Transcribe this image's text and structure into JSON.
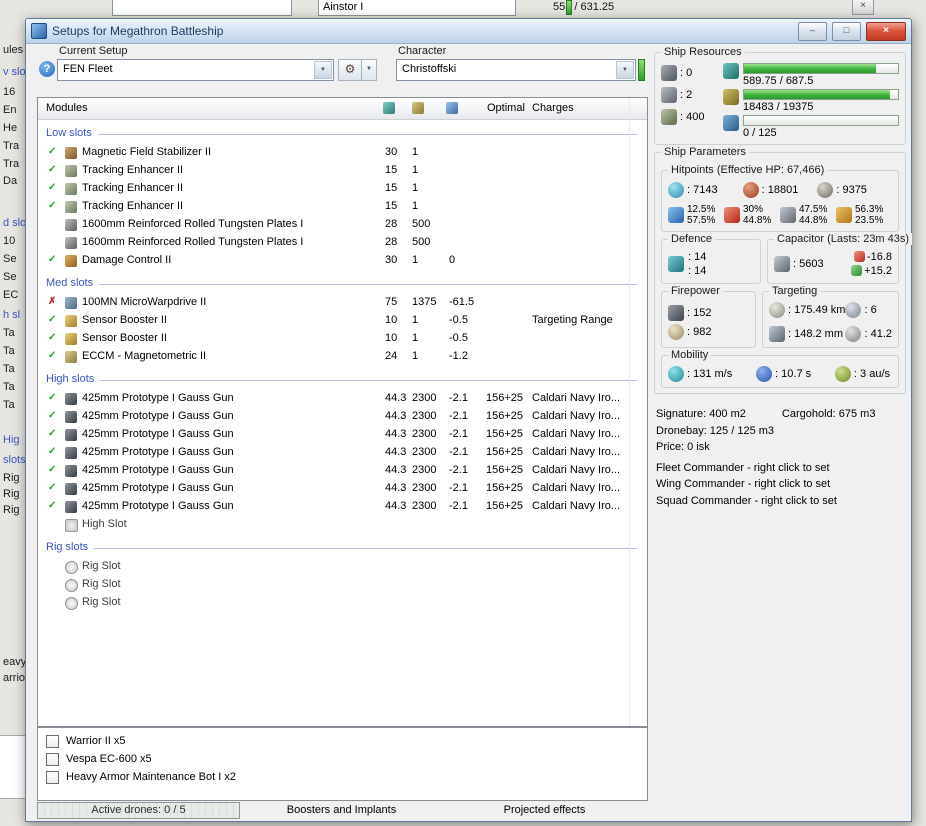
{
  "background": {
    "top_character": "Ainstor I",
    "top_value": "555 / 631.25",
    "close_glyph": "×",
    "left_fragments": [
      "ules",
      "v slot",
      "16",
      "En",
      "He",
      "Tra",
      "Tra",
      "Da",
      "d slot",
      "10",
      "Se",
      "Se",
      "EC",
      "h sl",
      "Ta",
      "Ta",
      "Ta",
      "Ta",
      "Ta",
      "Hig",
      "slots",
      "Rig",
      "Rig",
      "Rig",
      "eavy",
      "arrio"
    ]
  },
  "window": {
    "title": "Setups for Megathron Battleship",
    "minimize_glyph": "–",
    "maximize_glyph": "□",
    "close_glyph": "×"
  },
  "setup_bar": {
    "help_glyph": "?",
    "current_setup_label": "Current Setup",
    "current_setup_value": "FEN Fleet",
    "tool_glyph": "⚙",
    "dropdown_glyph": "▼",
    "character_label": "Character",
    "character_value": "Christoffski"
  },
  "modules_table": {
    "modules_header": "Modules",
    "optimal_header": "Optimal",
    "charges_header": "Charges",
    "sections": [
      {
        "label": "Low slots",
        "rows": [
          {
            "status": "ok",
            "icon": "magnetic-field-stabilizer-icon",
            "name": "Magnetic Field Stabilizer II",
            "cpu": "30",
            "pg": "1"
          },
          {
            "status": "ok",
            "icon": "tracking-enhancer-icon",
            "name": "Tracking Enhancer II",
            "cpu": "15",
            "pg": "1"
          },
          {
            "status": "ok",
            "icon": "tracking-enhancer-icon",
            "name": "Tracking Enhancer II",
            "cpu": "15",
            "pg": "1"
          },
          {
            "status": "ok",
            "icon": "tracking-enhancer-icon",
            "name": "Tracking Enhancer II",
            "cpu": "15",
            "pg": "1"
          },
          {
            "status": "none",
            "icon": "armor-plate-icon",
            "name": "1600mm Reinforced Rolled Tungsten Plates I",
            "cpu": "28",
            "pg": "500"
          },
          {
            "status": "none",
            "icon": "armor-plate-icon",
            "name": "1600mm Reinforced Rolled Tungsten Plates I",
            "cpu": "28",
            "pg": "500"
          },
          {
            "status": "ok",
            "icon": "damage-control-icon",
            "name": "Damage Control II",
            "cpu": "30",
            "pg": "1",
            "cap": "0"
          }
        ]
      },
      {
        "label": "Med slots",
        "rows": [
          {
            "status": "bad",
            "icon": "microwarpdrive-icon",
            "name": "100MN MicroWarpdrive II",
            "cpu": "75",
            "pg": "1375",
            "cap": "-61.5"
          },
          {
            "status": "ok",
            "icon": "sensor-booster-icon",
            "name": "Sensor Booster II",
            "cpu": "10",
            "pg": "1",
            "cap": "-0.5",
            "charges": "Targeting Range"
          },
          {
            "status": "ok",
            "icon": "sensor-booster-icon",
            "name": "Sensor Booster II",
            "cpu": "10",
            "pg": "1",
            "cap": "-0.5"
          },
          {
            "status": "ok",
            "icon": "eccm-icon",
            "name": "ECCM - Magnetometric II",
            "cpu": "24",
            "pg": "1",
            "cap": "-1.2"
          }
        ]
      },
      {
        "label": "High slots",
        "rows": [
          {
            "status": "ok",
            "icon": "railgun-icon",
            "name": "425mm Prototype I Gauss Gun",
            "cpu": "44.3",
            "pg": "2300",
            "cap": "-2.1",
            "optimal": "156+25",
            "charges": "Caldari Navy Iro..."
          },
          {
            "status": "ok",
            "icon": "railgun-icon",
            "name": "425mm Prototype I Gauss Gun",
            "cpu": "44.3",
            "pg": "2300",
            "cap": "-2.1",
            "optimal": "156+25",
            "charges": "Caldari Navy Iro..."
          },
          {
            "status": "ok",
            "icon": "railgun-icon",
            "name": "425mm Prototype I Gauss Gun",
            "cpu": "44.3",
            "pg": "2300",
            "cap": "-2.1",
            "optimal": "156+25",
            "charges": "Caldari Navy Iro..."
          },
          {
            "status": "ok",
            "icon": "railgun-icon",
            "name": "425mm Prototype I Gauss Gun",
            "cpu": "44.3",
            "pg": "2300",
            "cap": "-2.1",
            "optimal": "156+25",
            "charges": "Caldari Navy Iro..."
          },
          {
            "status": "ok",
            "icon": "railgun-icon",
            "name": "425mm Prototype I Gauss Gun",
            "cpu": "44.3",
            "pg": "2300",
            "cap": "-2.1",
            "optimal": "156+25",
            "charges": "Caldari Navy Iro..."
          },
          {
            "status": "ok",
            "icon": "railgun-icon",
            "name": "425mm Prototype I Gauss Gun",
            "cpu": "44.3",
            "pg": "2300",
            "cap": "-2.1",
            "optimal": "156+25",
            "charges": "Caldari Navy Iro..."
          },
          {
            "status": "ok",
            "icon": "railgun-icon",
            "name": "425mm Prototype I Gauss Gun",
            "cpu": "44.3",
            "pg": "2300",
            "cap": "-2.1",
            "optimal": "156+25",
            "charges": "Caldari Navy Iro..."
          },
          {
            "status": "none",
            "icon": "empty-high-slot-icon",
            "name": "High Slot",
            "empty": true
          }
        ]
      },
      {
        "label": "Rig slots",
        "rows": [
          {
            "status": "none",
            "icon": "rig-slot-icon",
            "name": "Rig Slot",
            "empty": true
          },
          {
            "status": "none",
            "icon": "rig-slot-icon",
            "name": "Rig Slot",
            "empty": true
          },
          {
            "status": "none",
            "icon": "rig-slot-icon",
            "name": "Rig Slot",
            "empty": true
          }
        ]
      }
    ]
  },
  "ship_resources": {
    "label": "Ship Resources",
    "hardpoints": [
      {
        "icon": "turret-hardpoints-icon",
        "value": ": 0"
      },
      {
        "icon": "launcher-hardpoints-icon",
        "value": ": 2"
      },
      {
        "icon": "calibration-icon",
        "value": ": 400"
      }
    ],
    "bars": [
      {
        "icon": "cpu-icon",
        "text": "589.75 / 687.5",
        "fill_pct": 86
      },
      {
        "icon": "powergrid-icon",
        "text": "18483 / 19375",
        "fill_pct": 95
      },
      {
        "icon": "drone-bandwidth-icon",
        "text": "0 / 125",
        "fill_pct": 0
      }
    ]
  },
  "ship_parameters": {
    "label": "Ship Parameters",
    "hitpoints": {
      "label": "Hitpoints (Effective HP: 67,466)",
      "shield": ": 7143",
      "armor": ": 18801",
      "hull": ": 9375",
      "resists": [
        {
          "top": "12.5%",
          "bottom": "57.5%"
        },
        {
          "top": "30%",
          "bottom": "44.8%"
        },
        {
          "top": "47.5%",
          "bottom": "44.8%"
        },
        {
          "top": "56.3%",
          "bottom": "23.5%"
        }
      ]
    },
    "defence": {
      "label": "Defence",
      "value1": ": 14",
      "value2": ": 14"
    },
    "capacitor": {
      "label": "Capacitor (Lasts: 23m 43s)",
      "capacity": ": 5603",
      "drain": "-16.8",
      "recharge": "+15.2"
    },
    "firepower": {
      "label": "Firepower",
      "volley": ": 152",
      "dps": ": 982"
    },
    "targeting": {
      "label": "Targeting",
      "range": ": 175.49 km",
      "max_targets": ": 6",
      "scan_resolution": ": 148.2 mm",
      "sensor_strength": ": 41.2"
    },
    "mobility": {
      "label": "Mobility",
      "speed": ": 131 m/s",
      "align_time": ": 10.7 s",
      "warp_speed": ": 3 au/s"
    },
    "info": {
      "signature": "Signature: 400 m2",
      "cargohold": "Cargohold: 675 m3",
      "dronebay": "Dronebay: 125 / 125 m3",
      "price": "Price: 0 isk",
      "fleet_commander": "Fleet Commander - right click to set",
      "wing_commander": "Wing Commander - right click to set",
      "squad_commander": "Squad Commander - right click to set"
    }
  },
  "drones": {
    "items": [
      {
        "label": "Warrior II x5"
      },
      {
        "label": "Vespa EC-600 x5"
      },
      {
        "label": "Heavy Armor Maintenance Bot I x2"
      }
    ]
  },
  "bottom_bar": {
    "active_drones": "Active drones: 0 / 5",
    "boosters": "Boosters and Implants",
    "projected": "Projected effects"
  }
}
